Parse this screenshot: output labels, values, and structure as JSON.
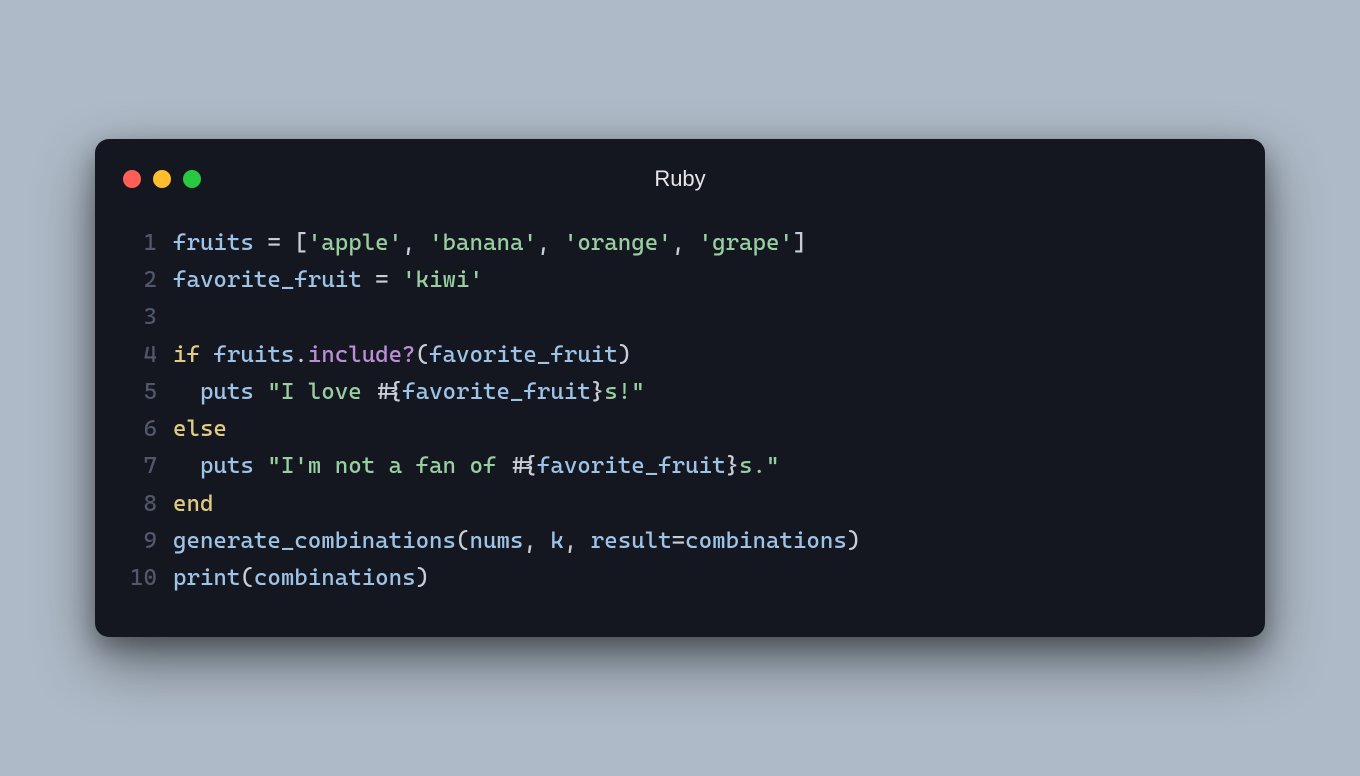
{
  "window": {
    "title": "Ruby"
  },
  "code": {
    "lines": [
      {
        "n": "1",
        "tokens": [
          {
            "c": "tok-ident",
            "t": "fruits "
          },
          {
            "c": "tok-op",
            "t": "= ["
          },
          {
            "c": "tok-str",
            "t": "'apple'"
          },
          {
            "c": "tok-op",
            "t": ", "
          },
          {
            "c": "tok-str",
            "t": "'banana'"
          },
          {
            "c": "tok-op",
            "t": ", "
          },
          {
            "c": "tok-str",
            "t": "'orange'"
          },
          {
            "c": "tok-op",
            "t": ", "
          },
          {
            "c": "tok-str",
            "t": "'grape'"
          },
          {
            "c": "tok-op",
            "t": "]"
          }
        ]
      },
      {
        "n": "2",
        "tokens": [
          {
            "c": "tok-ident",
            "t": "favorite_fruit "
          },
          {
            "c": "tok-op",
            "t": "= "
          },
          {
            "c": "tok-str",
            "t": "'kiwi'"
          }
        ]
      },
      {
        "n": "3",
        "tokens": []
      },
      {
        "n": "4",
        "tokens": [
          {
            "c": "tok-kw",
            "t": "if"
          },
          {
            "c": "tok-ident",
            "t": " fruits"
          },
          {
            "c": "tok-op",
            "t": "."
          },
          {
            "c": "tok-func",
            "t": "include?"
          },
          {
            "c": "tok-op",
            "t": "("
          },
          {
            "c": "tok-ident",
            "t": "favorite_fruit"
          },
          {
            "c": "tok-op",
            "t": ")"
          }
        ]
      },
      {
        "n": "5",
        "tokens": [
          {
            "c": "tok-ident",
            "t": "  puts "
          },
          {
            "c": "tok-str",
            "t": "\"I love "
          },
          {
            "c": "tok-op",
            "t": "#{"
          },
          {
            "c": "tok-interp",
            "t": "favorite_fruit"
          },
          {
            "c": "tok-op",
            "t": "}"
          },
          {
            "c": "tok-str",
            "t": "s!\""
          }
        ]
      },
      {
        "n": "6",
        "tokens": [
          {
            "c": "tok-kw",
            "t": "else"
          }
        ]
      },
      {
        "n": "7",
        "tokens": [
          {
            "c": "tok-ident",
            "t": "  puts "
          },
          {
            "c": "tok-str",
            "t": "\"I'm not a fan of "
          },
          {
            "c": "tok-op",
            "t": "#{"
          },
          {
            "c": "tok-interp",
            "t": "favorite_fruit"
          },
          {
            "c": "tok-op",
            "t": "}"
          },
          {
            "c": "tok-str",
            "t": "s.\""
          }
        ]
      },
      {
        "n": "8",
        "tokens": [
          {
            "c": "tok-kw",
            "t": "end"
          }
        ]
      },
      {
        "n": "9",
        "tokens": [
          {
            "c": "tok-ident",
            "t": "generate_combinations"
          },
          {
            "c": "tok-op",
            "t": "("
          },
          {
            "c": "tok-ident",
            "t": "nums"
          },
          {
            "c": "tok-op",
            "t": ", "
          },
          {
            "c": "tok-ident",
            "t": "k"
          },
          {
            "c": "tok-op",
            "t": ", "
          },
          {
            "c": "tok-ident",
            "t": "result"
          },
          {
            "c": "tok-op",
            "t": "="
          },
          {
            "c": "tok-ident",
            "t": "combinations"
          },
          {
            "c": "tok-op",
            "t": ")"
          }
        ]
      },
      {
        "n": "10",
        "tokens": [
          {
            "c": "tok-ident",
            "t": "print"
          },
          {
            "c": "tok-op",
            "t": "("
          },
          {
            "c": "tok-ident",
            "t": "combinations"
          },
          {
            "c": "tok-op",
            "t": ")"
          }
        ]
      }
    ]
  }
}
